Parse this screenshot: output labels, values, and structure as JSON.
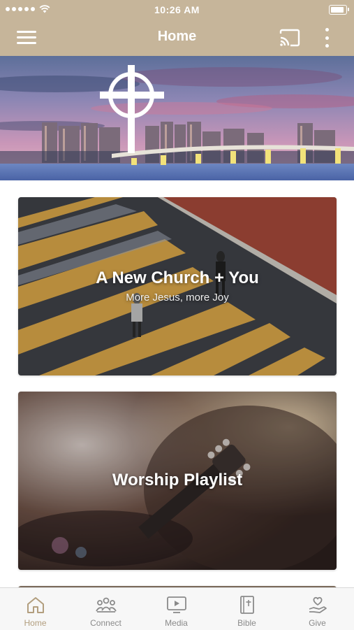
{
  "status_bar": {
    "time": "10:26 AM"
  },
  "nav": {
    "title": "Home"
  },
  "cards": [
    {
      "title": "A New Church + You",
      "subtitle": "More Jesus, more Joy"
    },
    {
      "title": "Worship Playlist"
    }
  ],
  "tabs": [
    {
      "label": "Home",
      "icon": "home-icon",
      "active": true
    },
    {
      "label": "Connect",
      "icon": "people-icon"
    },
    {
      "label": "Media",
      "icon": "play-screen-icon"
    },
    {
      "label": "Bible",
      "icon": "book-icon"
    },
    {
      "label": "Give",
      "icon": "heart-hand-icon"
    }
  ],
  "colors": {
    "accent": "#c6b59a",
    "active_tab": "#b29e7e",
    "inactive_tab": "#8a8a8a"
  }
}
